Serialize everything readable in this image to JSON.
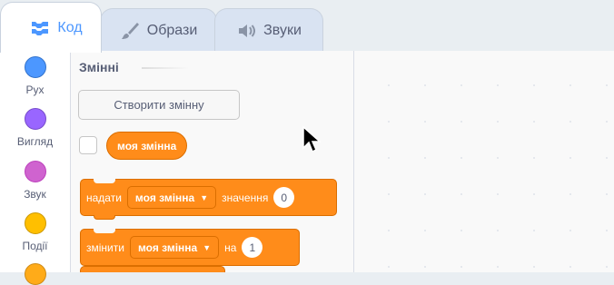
{
  "tabs": [
    {
      "label": "Код",
      "icon": "code-blocks-icon",
      "active": true
    },
    {
      "label": "Образи",
      "icon": "paintbrush-icon",
      "active": false
    },
    {
      "label": "Звуки",
      "icon": "speaker-icon",
      "active": false
    }
  ],
  "categories": [
    {
      "label": "Рух",
      "color": "#4c97ff",
      "border": "#3373cc"
    },
    {
      "label": "Вигляд",
      "color": "#9966ff",
      "border": "#774dcb"
    },
    {
      "label": "Звук",
      "color": "#cf63cf",
      "border": "#bd42bd"
    },
    {
      "label": "Події",
      "color": "#ffbf00",
      "border": "#cc9900"
    },
    {
      "label": "",
      "color": "#ffab19",
      "border": "#cf8b17"
    }
  ],
  "palette": {
    "section_title": "Змінні",
    "make_variable_label": "Створити змінну",
    "variable_reporter": "моя змінна",
    "variable_color": "#ff8c1a",
    "set_block": {
      "prefix": "надати",
      "variable": "моя змінна",
      "middle": "значення",
      "value": "0"
    },
    "change_block": {
      "prefix": "змінити",
      "variable": "моя змінна",
      "middle": "на",
      "value": "1"
    }
  }
}
